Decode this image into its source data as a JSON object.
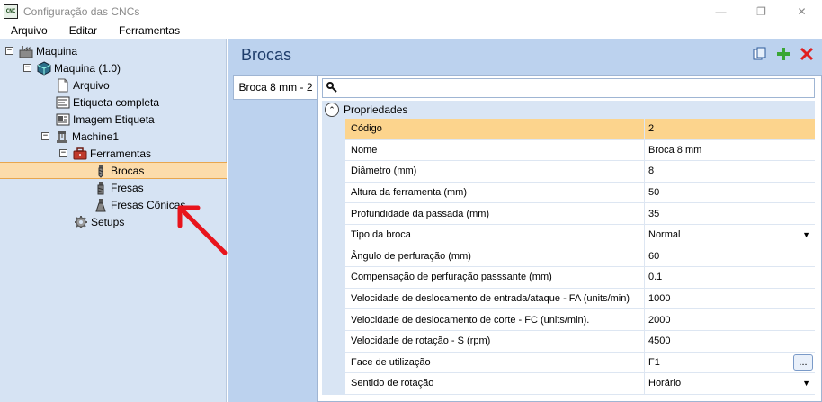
{
  "window": {
    "icon_label": "CNC",
    "title": "Configuração das CNCs",
    "controls": {
      "minimize": "—",
      "restore": "❐",
      "close": "✕"
    }
  },
  "menu": [
    "Arquivo",
    "Editar",
    "Ferramentas"
  ],
  "tree": {
    "items": [
      {
        "label": "Maquina",
        "icon": "factory-icon",
        "expander": "⊟"
      },
      {
        "label": "Maquina (1.0)",
        "icon": "cube-icon",
        "expander": "⊟"
      },
      {
        "label": "Arquivo",
        "icon": "file-icon"
      },
      {
        "label": "Etiqueta completa",
        "icon": "label-icon"
      },
      {
        "label": "Imagem Etiqueta",
        "icon": "image-label-icon"
      },
      {
        "label": "Machine1",
        "icon": "machine-icon",
        "expander": "⊟"
      },
      {
        "label": "Ferramentas",
        "icon": "toolbox-icon",
        "expander": "⊟"
      },
      {
        "label": "Brocas",
        "icon": "drill-bit-icon",
        "selected": true
      },
      {
        "label": "Fresas",
        "icon": "mill-icon"
      },
      {
        "label": "Fresas Cônicas",
        "icon": "conical-mill-icon"
      },
      {
        "label": "Setups",
        "icon": "gear-icon"
      }
    ]
  },
  "main": {
    "title": "Brocas",
    "toolbar": {
      "copy_icon": "copy-icon",
      "add_icon": "plus-icon",
      "delete_icon": "delete-icon"
    },
    "tabs": [
      {
        "label": "Broca 8 mm - 2"
      }
    ],
    "search_icon": "wrench-search-icon",
    "category": {
      "label": "Propriedades",
      "collapse_glyph": "⌃"
    },
    "properties": [
      {
        "name": "Código",
        "value": "2",
        "selected": true
      },
      {
        "name": "Nome",
        "value": "Broca 8 mm"
      },
      {
        "name": "Diâmetro (mm)",
        "value": "8"
      },
      {
        "name": "Altura da ferramenta (mm)",
        "value": "50"
      },
      {
        "name": "Profundidade da passada (mm)",
        "value": "35"
      },
      {
        "name": "Tipo da broca",
        "value": "Normal",
        "dropdown": true
      },
      {
        "name": "Ângulo de perfuração (mm)",
        "value": "60"
      },
      {
        "name": "Compensação de perfuração passsante (mm)",
        "value": "0.1"
      },
      {
        "name": "Velocidade de deslocamento de entrada/ataque - FA (units/min)",
        "value": "1000"
      },
      {
        "name": "Velocidade de deslocamento de corte - FC (units/min).",
        "value": "2000"
      },
      {
        "name": "Velocidade de rotação - S (rpm)",
        "value": "4500"
      },
      {
        "name": "Face de utilização",
        "value": "F1",
        "ellipsis": "..."
      },
      {
        "name": "Sentido de rotação",
        "value": "Horário",
        "dropdown": true
      }
    ]
  },
  "colors": {
    "selection": "#fcdcab",
    "tree_bg": "#d6e3f3",
    "panel_bg": "#bcd2ee",
    "annotation_arrow": "#e8141c"
  }
}
